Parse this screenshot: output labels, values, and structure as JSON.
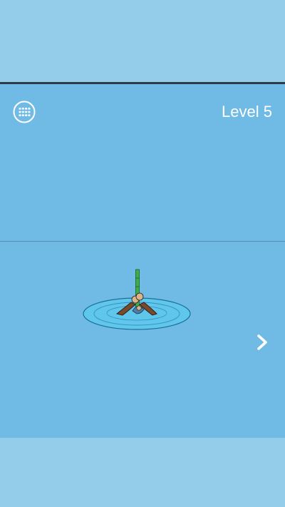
{
  "hud": {
    "level_label": "Level 5",
    "menu_icon": "grid-menu-icon",
    "next_icon": "chevron-right-icon"
  },
  "scene": {
    "description_icon": "drowning-person-holding-bamboo-icon"
  },
  "colors": {
    "background": "#6fbbe6",
    "band": "#93cdea",
    "divider": "#2f3c47",
    "pond": "#5fc6ec",
    "bamboo": "#3fae4a"
  }
}
